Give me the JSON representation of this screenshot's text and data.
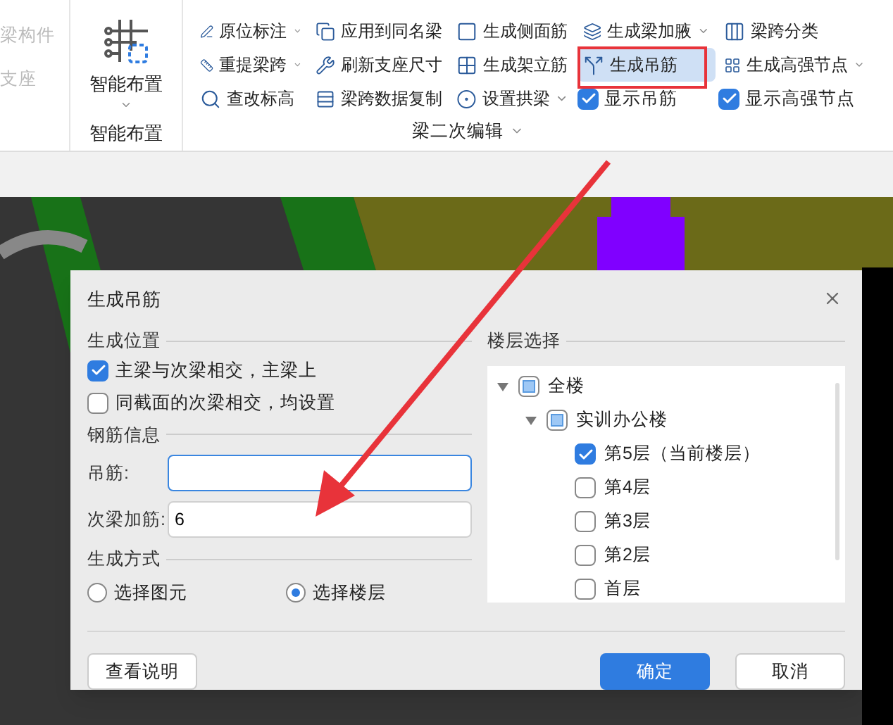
{
  "ribbon": {
    "left_items": [
      {
        "label": "梁构件",
        "disabled": true
      },
      {
        "label": "支座",
        "disabled": true
      }
    ],
    "smart_layout": {
      "label": "智能布置",
      "group": "智能布置"
    },
    "tool_columns": [
      [
        {
          "label": "原位标注",
          "kind": "dropdown",
          "selected": false
        },
        {
          "label": "重提梁跨",
          "kind": "dropdown",
          "selected": false
        },
        {
          "label": "查改标高",
          "kind": "button",
          "selected": false
        }
      ],
      [
        {
          "label": "应用到同名梁",
          "kind": "button",
          "selected": false
        },
        {
          "label": "刷新支座尺寸",
          "kind": "button",
          "selected": false
        },
        {
          "label": "梁跨数据复制",
          "kind": "button",
          "selected": false
        }
      ],
      [
        {
          "label": "生成侧面筋",
          "kind": "button",
          "selected": false
        },
        {
          "label": "生成架立筋",
          "kind": "button",
          "selected": false
        },
        {
          "label": "设置拱梁",
          "kind": "dropdown",
          "selected": false
        }
      ],
      [
        {
          "label": "生成梁加腋",
          "kind": "dropdown",
          "selected": false
        },
        {
          "label": "生成吊筋",
          "kind": "button",
          "selected": true
        },
        {
          "label": "显示吊筋",
          "kind": "checkbox",
          "checked": true
        }
      ],
      [
        {
          "label": "梁跨分类",
          "kind": "button",
          "selected": false
        },
        {
          "label": "生成高强节点",
          "kind": "dropdown",
          "selected": false
        },
        {
          "label": "显示高强节点",
          "kind": "checkbox",
          "checked": true
        }
      ]
    ],
    "group": "梁二次编辑"
  },
  "dialog": {
    "title": "生成吊筋",
    "position_section": "生成位置",
    "position_options": [
      {
        "label": "主梁与次梁相交，主梁上",
        "checked": true
      },
      {
        "label": "同截面的次梁相交，均设置",
        "checked": false
      }
    ],
    "rebar_section": "钢筋信息",
    "fields": [
      {
        "label": "吊筋:",
        "focused": true
      },
      {
        "label": "次梁加筋:",
        "value": "6",
        "focused": false
      }
    ],
    "method_section": "生成方式",
    "methods": [
      {
        "label": "选择图元",
        "selected": false
      },
      {
        "label": "选择楼层",
        "selected": true
      }
    ],
    "floor_section": "楼层选择",
    "tree": [
      {
        "label": "全楼",
        "partial": true,
        "expanded": true,
        "children": [
          {
            "label": "实训办公楼",
            "partial": true,
            "expanded": true,
            "children": [
              {
                "label": "第5层（当前楼层）",
                "checked": true
              },
              {
                "label": "第4层",
                "checked": false
              },
              {
                "label": "第3层",
                "checked": false
              },
              {
                "label": "第2层",
                "checked": false
              },
              {
                "label": "首层",
                "checked": false
              }
            ]
          }
        ]
      }
    ],
    "buttons": [
      {
        "label": "查看说明",
        "kind": "secondary"
      },
      {
        "label": "确定",
        "kind": "primary"
      },
      {
        "label": "取消",
        "kind": "secondary"
      }
    ]
  }
}
